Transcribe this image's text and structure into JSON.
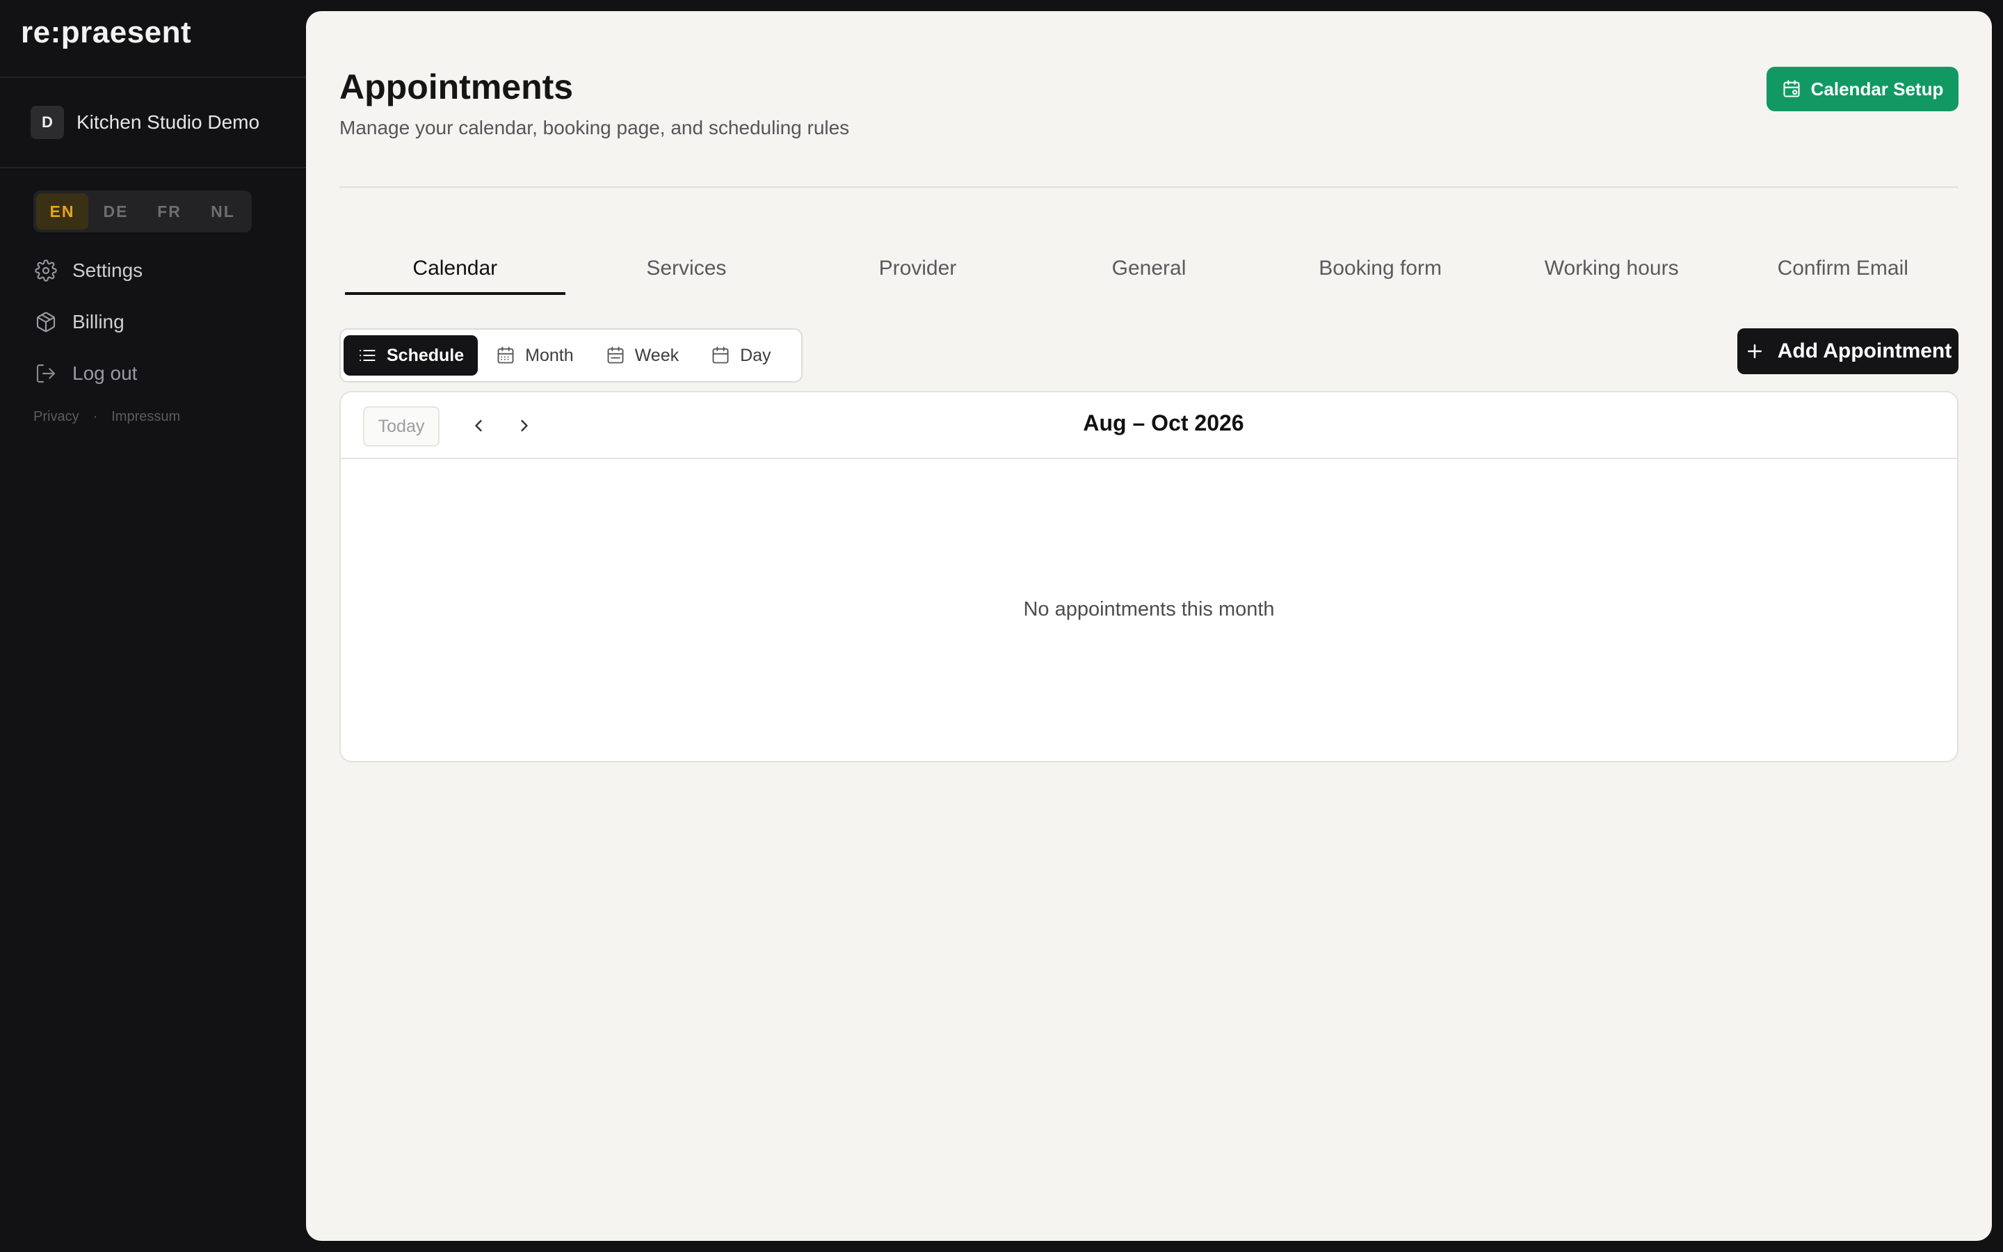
{
  "sidebar": {
    "logo": "re:praesent",
    "org": {
      "initial": "D",
      "name": "Kitchen Studio Demo"
    },
    "languages": [
      {
        "code": "EN",
        "active": true
      },
      {
        "code": "DE",
        "active": false
      },
      {
        "code": "FR",
        "active": false
      },
      {
        "code": "NL",
        "active": false
      }
    ],
    "nav": {
      "settings": {
        "label": "Settings",
        "icon": "gear-icon"
      },
      "billing": {
        "label": "Billing",
        "icon": "package-icon"
      },
      "logout": {
        "label": "Log out",
        "icon": "logout-icon"
      }
    },
    "footer": {
      "privacy": "Privacy",
      "separator": "·",
      "impressum": "Impressum"
    }
  },
  "header": {
    "title": "Appointments",
    "subtitle": "Manage your calendar, booking page, and scheduling rules",
    "setup_button": "Calendar Setup"
  },
  "tabs": [
    {
      "label": "Calendar",
      "active": true
    },
    {
      "label": "Services",
      "active": false
    },
    {
      "label": "Provider",
      "active": false
    },
    {
      "label": "General",
      "active": false
    },
    {
      "label": "Booking form",
      "active": false
    },
    {
      "label": "Working hours",
      "active": false
    },
    {
      "label": "Confirm Email",
      "active": false
    }
  ],
  "views": [
    {
      "label": "Schedule",
      "icon": "list-icon",
      "active": true
    },
    {
      "label": "Month",
      "icon": "calendar-month-icon",
      "active": false
    },
    {
      "label": "Week",
      "icon": "calendar-week-icon",
      "active": false
    },
    {
      "label": "Day",
      "icon": "calendar-day-icon",
      "active": false
    }
  ],
  "add_button": "Add Appointment",
  "calendar": {
    "today_label": "Today",
    "range": "Aug – Oct 2026",
    "empty_message": "No appointments this month"
  },
  "colors": {
    "accent_green": "#129963",
    "active_lang": "#e7a51a",
    "dark": "#141416"
  }
}
